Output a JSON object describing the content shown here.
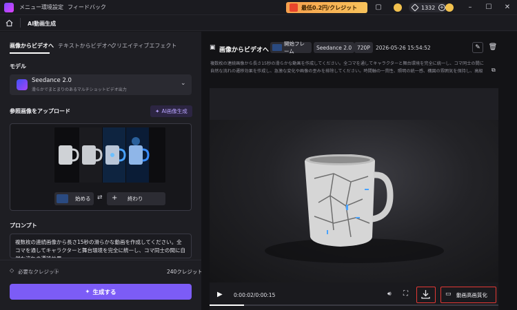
{
  "titlebar": {
    "menu": [
      "メニュー",
      "環境設定",
      "フィードバック"
    ],
    "promo": "最低0.2円/クレジット",
    "credits": "1332",
    "icons": [
      "app-logo-icon",
      "window-icon",
      "coin-icon",
      "gem-icon",
      "plus-icon",
      "avatar-icon",
      "minimize-icon",
      "maximize-icon",
      "close-icon"
    ]
  },
  "subheader": {
    "title": "AI動画生成"
  },
  "left": {
    "tabs": [
      "画像からビデオへ",
      "テキストからビデオへ",
      "クリエイティブエフェクト"
    ],
    "model_label": "モデル",
    "model": {
      "name": "Seedance 2.0",
      "desc": "滑らかでまとまりのあるマルチショットビデオ出力"
    },
    "ref_label": "参照画像をアップロード",
    "ai_gen_label": "AI画像生成",
    "start_label": "始める",
    "end_label": "終わり",
    "prompt_label": "プロンプト",
    "prompt_text": "複数枚の連続画像から長さ15秒の滑らかな動画を作成してください。全コマを通してキャラクターと舞台環境を完全に統一し、コマ同士の間に自然な流れの遷移効果",
    "need_credit": "必要なクレジット",
    "credit_value": "240クレジット",
    "generate_label": "生成する"
  },
  "right": {
    "title": "画像からビデオへ",
    "tags": [
      "開始フレーム",
      "Seedance 2.0",
      "720P"
    ],
    "datetime": "2026-05-26 15:54:52",
    "description": "複数枚の連続画像から長さ15秒の滑らかな動画を作成してください。全コマを通してキャラクターと舞台環境を完全に統一し、コマ同士の間に自然な流れの遷移効果を作成し、急激な変化や画像の歪みを排除してください。時間軸の一貫性、照明の統一感、構図の雰囲気を保持し、高級撮影機器で撮影したようなシネマ風の滑らかな動きとリアルなアニメーションの流れを再現してください",
    "time": "0:00:02/0:00:15",
    "progress": 0.12,
    "enhance_label": "動画高画質化"
  }
}
